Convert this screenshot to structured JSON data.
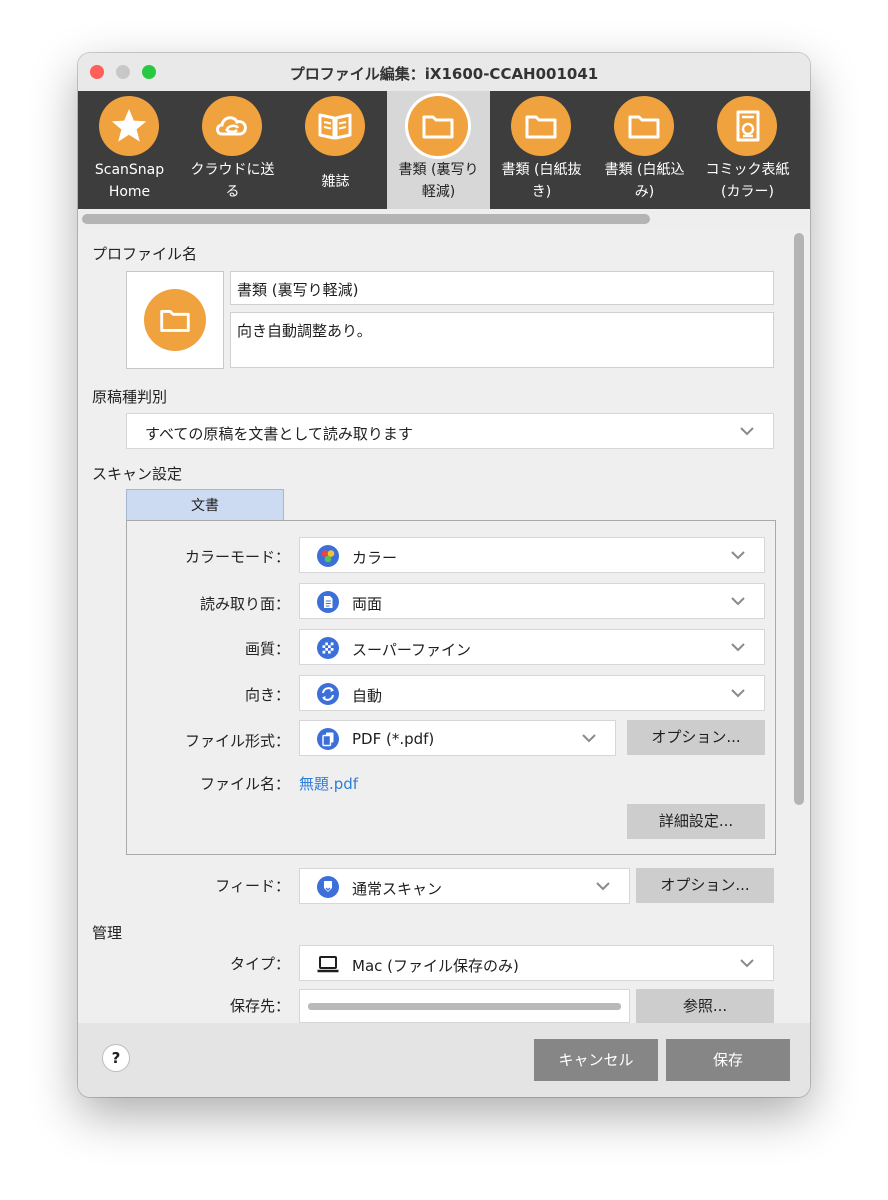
{
  "window": {
    "title": "プロファイル編集：iX1600-CCAH001041"
  },
  "profiles": [
    {
      "line1": "ScanSnap",
      "line2": "Home",
      "icon": "star-icon"
    },
    {
      "line1": "クラウドに送",
      "line2": "る",
      "icon": "cloud-icon"
    },
    {
      "line1": "雑誌",
      "line2": "",
      "icon": "book-icon"
    },
    {
      "line1": "書類 (裏写り",
      "line2": "軽減)",
      "icon": "folder-icon"
    },
    {
      "line1": "書類 (白紙抜",
      "line2": "き)",
      "icon": "folder-icon"
    },
    {
      "line1": "書類 (白紙込",
      "line2": "み)",
      "icon": "folder-icon"
    },
    {
      "line1": "コミック表紙",
      "line2": "(カラー)",
      "icon": "comic-icon"
    }
  ],
  "selected_profile_index": 3,
  "profile_name": {
    "label": "プロファイル名",
    "name": "書類 (裏写り軽減)",
    "comment": "向き自動調整あり。"
  },
  "doc_type": {
    "label": "原稿種判別",
    "value": "すべての原稿を文書として読み取ります"
  },
  "scan_settings": {
    "label": "スキャン設定",
    "tab": "文書",
    "color_mode": {
      "label": "カラーモード：",
      "value": "カラー",
      "icon": "color-palette-icon"
    },
    "scan_side": {
      "label": "読み取り面：",
      "value": "両面",
      "icon": "duplex-page-icon"
    },
    "quality": {
      "label": "画質：",
      "value": "スーパーファイン",
      "icon": "quality-checker-icon"
    },
    "orientation": {
      "label": "向き：",
      "value": "自動",
      "icon": "auto-rotate-icon"
    },
    "file_format": {
      "label": "ファイル形式：",
      "value": "PDF (*.pdf)",
      "icon": "pdf-pages-icon",
      "options_label": "オプション..."
    },
    "file_name": {
      "label": "ファイル名：",
      "value": "無題.pdf"
    },
    "detail_label": "詳細設定..."
  },
  "feed": {
    "label": "フィード：",
    "value": "通常スキャン",
    "icon": "feed-scan-icon",
    "options_label": "オプション..."
  },
  "management": {
    "label": "管理",
    "type": {
      "label": "タイプ：",
      "value": "Mac (ファイル保存のみ)",
      "icon": "laptop-icon"
    },
    "save_to": {
      "label": "保存先：",
      "browse_label": "参照..."
    }
  },
  "footer": {
    "help": "?",
    "cancel": "キャンセル",
    "save": "保存"
  },
  "colors": {
    "accent_orange": "#efa23e",
    "tab_bg": "#3d3d3d",
    "link": "#2f7ed8"
  }
}
